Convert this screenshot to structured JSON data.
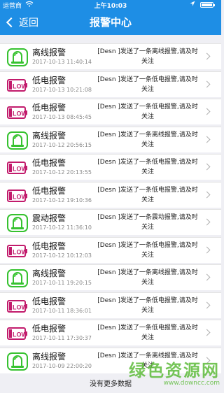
{
  "status_bar": {
    "carrier": "运营商",
    "time": "上午10:03"
  },
  "nav": {
    "back_label": "返回",
    "title": "报警中心"
  },
  "alarms": [
    {
      "type": "offline",
      "title": "离线报警",
      "time": "2017-10-13 11:40:14",
      "message": "[Desn ]发送了一条离线报警,请及时关注"
    },
    {
      "type": "low",
      "title": "低电报警",
      "time": "2017-10-13 10:21:08",
      "message": "[Desn ]发送了一条低电报警,请及时关注"
    },
    {
      "type": "low",
      "title": "低电报警",
      "time": "2017-10-13 08:45:45",
      "message": "[Desn ]发送了一条低电报警,请及时关注"
    },
    {
      "type": "offline",
      "title": "离线报警",
      "time": "2017-10-12 20:56:15",
      "message": "[Desn ]发送了一条离线报警,请及时关注"
    },
    {
      "type": "low",
      "title": "低电报警",
      "time": "2017-10-12 20:13:55",
      "message": "[Desn ]发送了一条低电报警,请及时关注"
    },
    {
      "type": "low",
      "title": "低电报警",
      "time": "2017-10-12 19:10:36",
      "message": "[Desn ]发送了一条低电报警,请及时关注"
    },
    {
      "type": "offline",
      "title": "震动报警",
      "time": "2017-10-12 11:36:10",
      "message": "[Desn ]发送了一条震动报警,请及时关注"
    },
    {
      "type": "low",
      "title": "低电报警",
      "time": "2017-10-12 10:12:03",
      "message": "[Desn ]发送了一条低电报警,请及时关注"
    },
    {
      "type": "offline",
      "title": "离线报警",
      "time": "2017-10-11 19:20:15",
      "message": "[Desn ]发送了一条离线报警,请及时关注"
    },
    {
      "type": "low",
      "title": "低电报警",
      "time": "2017-10-11 18:36:01",
      "message": "[Desn ]发送了一条低电报警,请及时关注"
    },
    {
      "type": "low",
      "title": "低电报警",
      "time": "2017-10-11 17:30:37",
      "message": "[Desn ]发送了一条低电报警,请及时关注"
    },
    {
      "type": "offline",
      "title": "离线报警",
      "time": "2017-10-09 22:00:20",
      "message": "[Desn ]发送了一条离线报警,请及时关注"
    }
  ],
  "footer": {
    "label": "没有更多数据"
  },
  "watermark": {
    "title": "绿色资源网",
    "url": "www.downcc.com"
  },
  "colors": {
    "nav": "#1e8ee5",
    "offline_icon": "#36c22f",
    "low_icon": "#c21b6c"
  }
}
